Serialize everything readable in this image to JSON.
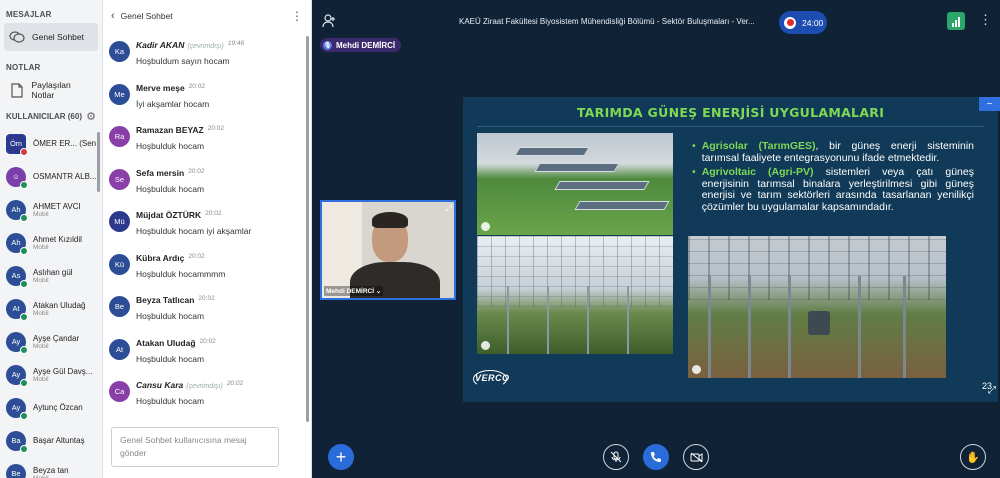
{
  "sidebar": {
    "messages_header": "MESAJLAR",
    "general_chat": "Genel Sohbet",
    "notes_header": "NOTLAR",
    "shared_notes": "Paylaşılan Notlar",
    "users_header": "KULLANICILAR (60)",
    "users": [
      {
        "initials": "Öm",
        "name": "ÖMER ER... (Sen)",
        "sub": "",
        "color": "#2b3a8c",
        "square": true,
        "status": "red"
      },
      {
        "initials": "☺",
        "name": "OSMANTR ALB...",
        "sub": "",
        "color": "#7a3fa8",
        "square": false,
        "status": "green"
      },
      {
        "initials": "Ah",
        "name": "AHMET AVCI",
        "sub": "Mobil",
        "color": "#2d4e96",
        "square": false,
        "status": "green"
      },
      {
        "initials": "Ah",
        "name": "Ahmet Kızıldil",
        "sub": "Mobil",
        "color": "#2d4e96",
        "square": false,
        "status": "green"
      },
      {
        "initials": "As",
        "name": "Aslıhan gül",
        "sub": "Mobil",
        "color": "#2d4e96",
        "square": false,
        "status": "green"
      },
      {
        "initials": "At",
        "name": "Atakan Uludağ",
        "sub": "Mobil",
        "color": "#2d4e96",
        "square": false,
        "status": "green"
      },
      {
        "initials": "Ay",
        "name": "Ayşe Çandar",
        "sub": "Mobil",
        "color": "#2d4e96",
        "square": false,
        "status": "green"
      },
      {
        "initials": "Ay",
        "name": "Ayşe Gül Davş...",
        "sub": "Mobil",
        "color": "#2d4e96",
        "square": false,
        "status": "green"
      },
      {
        "initials": "Ay",
        "name": "Aytunç Özcan",
        "sub": "",
        "color": "#2d4e96",
        "square": false,
        "status": "green"
      },
      {
        "initials": "Ba",
        "name": "Başar Altuntaş",
        "sub": "",
        "color": "#2d4e96",
        "square": false,
        "status": "green"
      },
      {
        "initials": "Be",
        "name": "Beyza tan",
        "sub": "Mobil",
        "color": "#2d4e96",
        "square": false,
        "status": "green"
      }
    ]
  },
  "chat": {
    "title": "Genel Sohbet",
    "messages": [
      {
        "initials": "Ka",
        "name": "Kadir AKAN",
        "status": "(çevrimdışı)",
        "time": "19:46",
        "text": "Hoşbuldum sayın hocam",
        "color": "#2d4e96",
        "italic": true
      },
      {
        "initials": "Me",
        "name": "Merve meşe",
        "status": "",
        "time": "20:02",
        "text": "İyi akşamlar hocam",
        "color": "#2d4e96",
        "italic": false
      },
      {
        "initials": "Ra",
        "name": "Ramazan BEYAZ",
        "status": "",
        "time": "20:02",
        "text": "Hoşbulduk hocam",
        "color": "#8a3fa8",
        "italic": false
      },
      {
        "initials": "Se",
        "name": "Sefa mersin",
        "status": "",
        "time": "20:02",
        "text": "Hoşbulduk hocam",
        "color": "#8a3fa8",
        "italic": false
      },
      {
        "initials": "Mü",
        "name": "Müjdat ÖZTÜRK",
        "status": "",
        "time": "20:02",
        "text": "Hoşbulduk hocam iyi akşamlar",
        "color": "#2b3a8c",
        "italic": false
      },
      {
        "initials": "Kü",
        "name": "Kübra Ardıç",
        "status": "",
        "time": "20:02",
        "text": "Hoşbulduk hocammmm",
        "color": "#2d4e96",
        "italic": false
      },
      {
        "initials": "Be",
        "name": "Beyza Tatlıcan",
        "status": "",
        "time": "20:02",
        "text": "Hoşbulduk hocam",
        "color": "#2d4e96",
        "italic": false
      },
      {
        "initials": "At",
        "name": "Atakan Uludağ",
        "status": "",
        "time": "20:02",
        "text": "Hoşbulduk hocam",
        "color": "#2d4e96",
        "italic": false
      },
      {
        "initials": "Ca",
        "name": "Cansu Kara",
        "status": "(çevrimdışı)",
        "time": "20:02",
        "text": "Hoşbulduk hocam",
        "color": "#8a3fa8",
        "italic": true
      }
    ],
    "input_placeholder": "Genel Sohbet kullanıcısına mesaj gönder"
  },
  "meeting": {
    "title": "KAEÜ Ziraat Fakültesi Biyosistem Mühendisliği Bölümü - Sektör Buluşmaları - Ver...",
    "timer": "24:00",
    "presenter": "Mehdi DEMİRCİ",
    "video_name": "Mehdi DEMİRCİ ⌄"
  },
  "slide": {
    "title": "TARIMDA GÜNEŞ ENERJİSİ UYGULAMALARI",
    "bullet1_highlight": "Agrisolar (TarımGES)",
    "bullet1_text": ", bir güneş enerji sisteminin tarımsal faaliyete entegrasyonunu ifade etmektedir.",
    "bullet2_highlight": "Agrivoltaic (Agri-PV)",
    "bullet2_text": " sistemleri veya çatı güneş enerjisinin tarımsal binalara yerleştirilmesi gibi güneş enerjisi ve tarım sektörleri arasında tasarlanan yenilikçi çözümler bu uygulamalar kapsamındadır.",
    "logo": "VERCO",
    "page": "23"
  },
  "colors": {
    "accent": "#2b6cdb",
    "slide_green": "#7ed957",
    "main_bg": "#0f2236"
  }
}
